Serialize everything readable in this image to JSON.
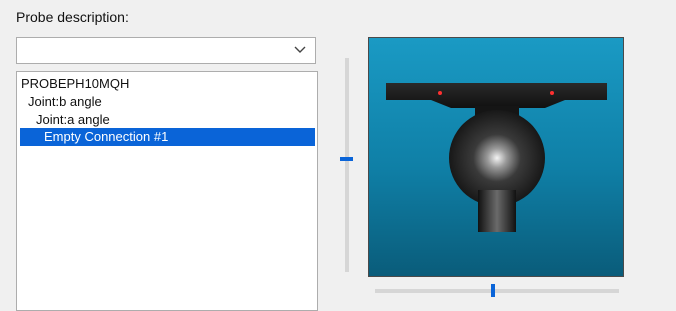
{
  "probe": {
    "label": "Probe description:",
    "combo_value": "",
    "tree": [
      {
        "text": "PROBEPH10MQH",
        "level": 0,
        "selected": false
      },
      {
        "text": "Joint:b angle",
        "level": 1,
        "selected": false
      },
      {
        "text": "Joint:a angle",
        "level": 2,
        "selected": false
      },
      {
        "text": "Empty Connection #1",
        "level": 3,
        "selected": true
      }
    ]
  },
  "colors": {
    "selection": "#0a64d8",
    "viewport_top": "#1a9ac4",
    "viewport_bottom": "#0a5c7a"
  }
}
